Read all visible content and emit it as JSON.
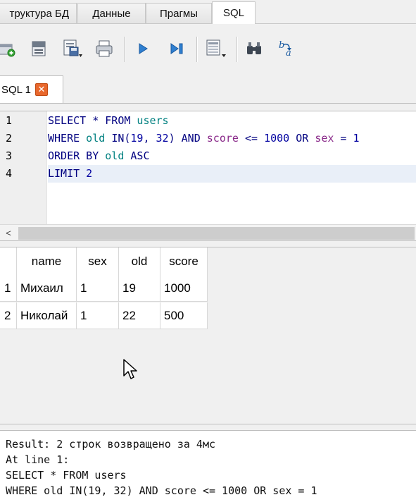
{
  "top_tabs": [
    {
      "label": "труктура БД",
      "active": false
    },
    {
      "label": "Данные",
      "active": false
    },
    {
      "label": "Прагмы",
      "active": false
    },
    {
      "label": "SQL",
      "active": true
    }
  ],
  "toolbar": {
    "buttons": [
      {
        "name": "open-tab-icon"
      },
      {
        "name": "open-sql-file-icon"
      },
      {
        "name": "save-sql-file-icon"
      },
      {
        "name": "print-icon"
      },
      {
        "name": "execute-all-icon"
      },
      {
        "name": "execute-current-line-icon"
      },
      {
        "name": "save-results-icon"
      },
      {
        "name": "find-icon"
      },
      {
        "name": "find-replace-icon"
      }
    ]
  },
  "editor_tab": {
    "label": "SQL 1",
    "close_icon": "close-icon"
  },
  "editor": {
    "line_numbers": [
      "1",
      "2",
      "3",
      "4"
    ],
    "lines": [
      {
        "tokens": [
          {
            "t": "SELECT",
            "c": "kw"
          },
          {
            "t": " * ",
            "c": "op"
          },
          {
            "t": "FROM",
            "c": "kw"
          },
          {
            "t": " users",
            "c": "id"
          }
        ]
      },
      {
        "tokens": [
          {
            "t": "WHERE",
            "c": "kw"
          },
          {
            "t": " old ",
            "c": "id"
          },
          {
            "t": "IN",
            "c": "kw"
          },
          {
            "t": "(",
            "c": "punct"
          },
          {
            "t": "19",
            "c": "num"
          },
          {
            "t": ", ",
            "c": "punct"
          },
          {
            "t": "32",
            "c": "num"
          },
          {
            "t": ") ",
            "c": "punct"
          },
          {
            "t": "AND",
            "c": "kw"
          },
          {
            "t": " score",
            "c": "fn"
          },
          {
            "t": " <= ",
            "c": "op"
          },
          {
            "t": "1000",
            "c": "num"
          },
          {
            "t": " OR ",
            "c": "kw"
          },
          {
            "t": "sex",
            "c": "fn"
          },
          {
            "t": " = ",
            "c": "op"
          },
          {
            "t": "1",
            "c": "num"
          }
        ]
      },
      {
        "tokens": [
          {
            "t": "ORDER BY",
            "c": "kw"
          },
          {
            "t": " old ",
            "c": "id"
          },
          {
            "t": "ASC",
            "c": "kw"
          }
        ]
      },
      {
        "tokens": [
          {
            "t": "LIMIT",
            "c": "kw"
          },
          {
            "t": " 2",
            "c": "num"
          }
        ]
      }
    ],
    "current_line": 4,
    "scroll_left_arrow": "<"
  },
  "results": {
    "columns": [
      "name",
      "sex",
      "old",
      "score"
    ],
    "row_numbers": [
      "1",
      "2"
    ],
    "rows": [
      [
        "Михаил",
        "1",
        "19",
        "1000"
      ],
      [
        "Николай",
        "1",
        "22",
        "500"
      ]
    ]
  },
  "log": {
    "lines": [
      "Result: 2 строк возвращено за 4мс",
      "At line 1:",
      "SELECT * FROM users",
      "WHERE old IN(19, 32) AND score <= 1000 OR sex = 1"
    ]
  },
  "colors": {
    "keyword": "#000080",
    "identifier": "#008080",
    "number": "#0000a0",
    "function": "#8a2a8a",
    "current_line_bg": "#e9eff8",
    "close_button": "#e8672c"
  }
}
